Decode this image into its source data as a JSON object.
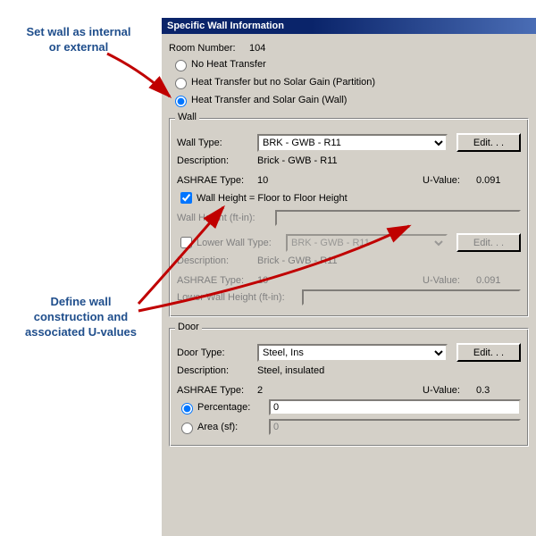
{
  "annotations": {
    "top": "Set wall as internal\nor external",
    "bottom": "Define wall\nconstruction and\nassociated U-values"
  },
  "titlebar": "Specific Wall Information",
  "roomNumber": {
    "label": "Room Number:",
    "value": "104"
  },
  "heatTransfer": {
    "opt1": "No Heat Transfer",
    "opt2": "Heat Transfer but no Solar Gain (Partition)",
    "opt3": "Heat Transfer and Solar Gain (Wall)"
  },
  "wallGroup": {
    "legend": "Wall",
    "wallTypeLabel": "Wall Type:",
    "wallType": "BRK - GWB - R11",
    "editBtn": "Edit. . .",
    "descLabel": "Description:",
    "desc": "Brick - GWB - R11",
    "ashraeLabel": "ASHRAE Type:",
    "ashrae": "10",
    "uvalLabel": "U-Value:",
    "uval": "0.091",
    "wallHeightChk": "Wall Height = Floor to Floor Height",
    "wallHeightLabel": "Wall Height (ft-in):",
    "lowerWallChk": "Lower Wall Type:",
    "lowerWallType": "BRK - GWB - R11",
    "lowerDesc": "Brick - GWB - R11",
    "lowerAshrae": "10",
    "lowerUval": "0.091",
    "lowerWallHeightLabel": "Lower Wall Height (ft-in):"
  },
  "doorGroup": {
    "legend": "Door",
    "doorTypeLabel": "Door Type:",
    "doorType": "Steel, Ins",
    "editBtn": "Edit. . .",
    "descLabel": "Description:",
    "desc": "Steel, insulated",
    "ashraeLabel": "ASHRAE Type:",
    "ashrae": "2",
    "uvalLabel": "U-Value:",
    "uval": "0.3",
    "pctLabel": "Percentage:",
    "pct": "0",
    "areaLabel": "Area (sf):",
    "area": "0"
  }
}
